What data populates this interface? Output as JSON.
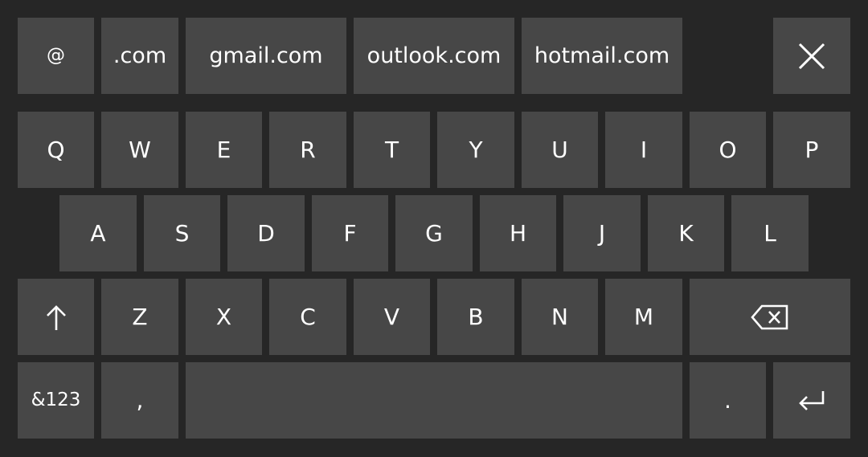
{
  "keyboard": {
    "suggestions": [
      "@",
      ".com",
      "gmail.com",
      "outlook.com",
      "hotmail.com"
    ],
    "row1": [
      "Q",
      "W",
      "E",
      "R",
      "T",
      "Y",
      "U",
      "I",
      "O",
      "P"
    ],
    "row2": [
      "A",
      "S",
      "D",
      "F",
      "G",
      "H",
      "J",
      "K",
      "L"
    ],
    "row3": [
      "Z",
      "X",
      "C",
      "V",
      "B",
      "N",
      "M"
    ],
    "symbols_label": "&123",
    "comma_label": ",",
    "period_label": "."
  },
  "icons": {
    "close": "close-icon",
    "shift": "shift-arrow-icon",
    "backspace": "backspace-icon",
    "enter": "enter-icon"
  },
  "colors": {
    "background": "#262626",
    "key": "#474747",
    "text": "#ffffff"
  }
}
